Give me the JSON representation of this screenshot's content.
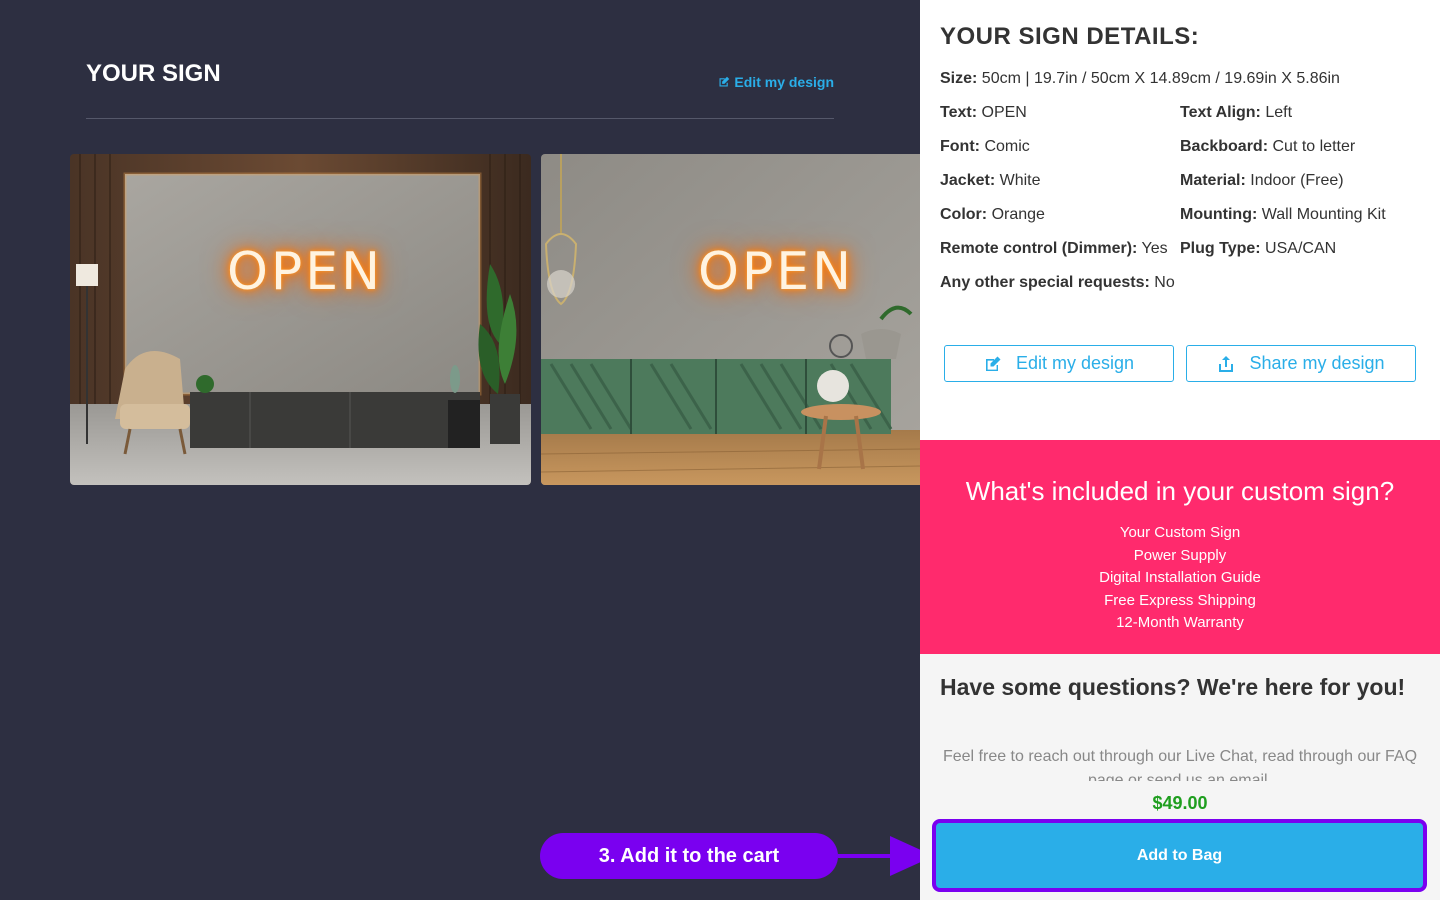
{
  "left": {
    "title": "YOUR SIGN",
    "edit_link": "Edit my design",
    "preview_text": "OPEN"
  },
  "details": {
    "title": "YOUR SIGN DETAILS:",
    "size": {
      "label": "Size:",
      "value": "50cm | 19.7in / 50cm X 14.89cm / 19.69in X 5.86in"
    },
    "text": {
      "label": "Text:",
      "value": "OPEN"
    },
    "text_align": {
      "label": "Text Align:",
      "value": "Left"
    },
    "font": {
      "label": "Font:",
      "value": "Comic"
    },
    "backboard": {
      "label": "Backboard:",
      "value": "Cut to letter"
    },
    "jacket": {
      "label": "Jacket:",
      "value": "White"
    },
    "material": {
      "label": "Material:",
      "value": "Indoor (Free)"
    },
    "color": {
      "label": "Color:",
      "value": "Orange"
    },
    "mounting": {
      "label": "Mounting:",
      "value": "Wall Mounting Kit"
    },
    "remote": {
      "label": "Remote control (Dimmer):",
      "value": "Yes"
    },
    "plug": {
      "label": "Plug Type:",
      "value": "USA/CAN"
    },
    "requests": {
      "label": "Any other special requests:",
      "value": "No"
    }
  },
  "buttons": {
    "edit": "Edit my design",
    "share": "Share my design",
    "add_to_bag": "Add to Bag"
  },
  "included": {
    "title": "What's included in your custom sign?",
    "items": [
      "Your Custom Sign",
      "Power Supply",
      "Digital Installation Guide",
      "Free Express Shipping",
      "12-Month Warranty"
    ]
  },
  "faq": {
    "title": "Have some questions? We're here for you!",
    "text": "Feel free to reach out through our Live Chat, read through our FAQ page or send us an email."
  },
  "price": "$49.00",
  "callout": "3. Add it to the cart",
  "colors": {
    "accent": "#2aaee8",
    "pink": "#ff2a6d",
    "purple": "#7a00f0",
    "price": "#1f9e1f",
    "dark_bg": "#2d2f41"
  }
}
